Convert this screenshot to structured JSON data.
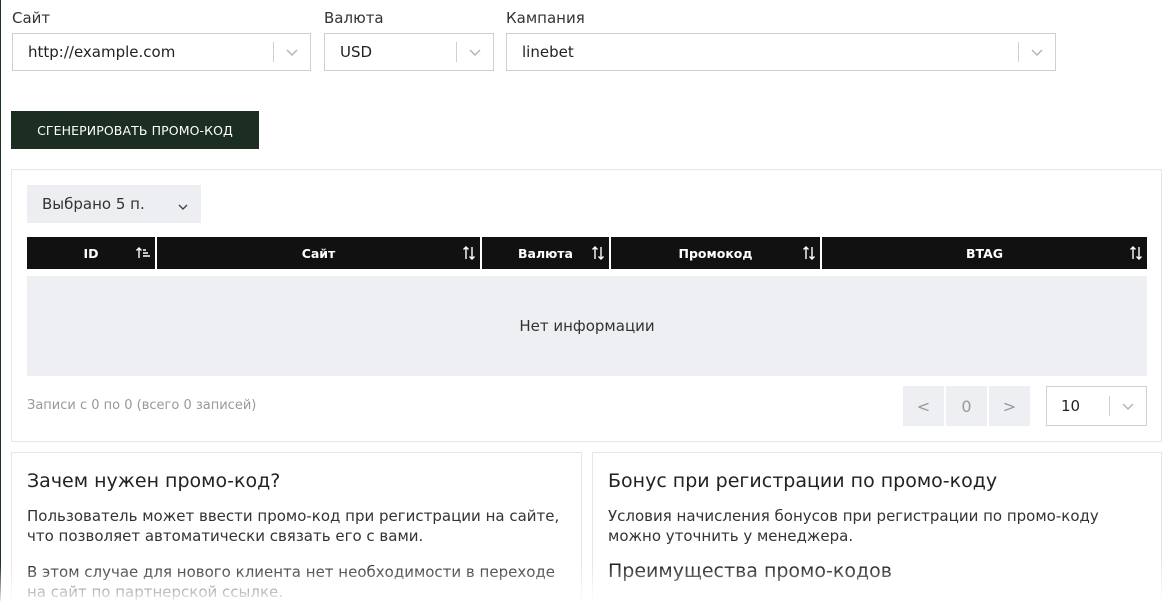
{
  "filters": {
    "site": {
      "label": "Сайт",
      "value": "http://example.com"
    },
    "currency": {
      "label": "Валюта",
      "value": "USD"
    },
    "campaign": {
      "label": "Кампания",
      "value": "linebet"
    }
  },
  "generate_button": "СГЕНЕРИРОВАТЬ ПРОМО-КОД",
  "table": {
    "column_selector": "Выбрано 5 п.",
    "columns": [
      "ID",
      "Сайт",
      "Валюта",
      "Промокод",
      "BTAG"
    ],
    "empty_text": "Нет информации",
    "records_info": "Записи с 0 по 0 (всего 0 записей)",
    "pagination": {
      "prev": "<",
      "page": "0",
      "next": ">"
    },
    "page_size": "10"
  },
  "info_left": {
    "title": "Зачем нужен промо-код?",
    "p1": "Пользователь может ввести промо-код при регистрации на сайте, что позволяет автоматически связать его с вами.",
    "p2": "В этом случае для нового клиента нет необходимости в переходе на сайт по партнерской ссылке."
  },
  "info_right": {
    "title": "Бонус при регистрации по промо-коду",
    "p1": "Условия начисления бонусов при регистрации по промо-коду можно уточнить у менеджера.",
    "title2": "Преимущества промо-кодов"
  },
  "colors": {
    "accent": "#1c2e22",
    "header": "#111111",
    "row": "#eeeff3"
  }
}
